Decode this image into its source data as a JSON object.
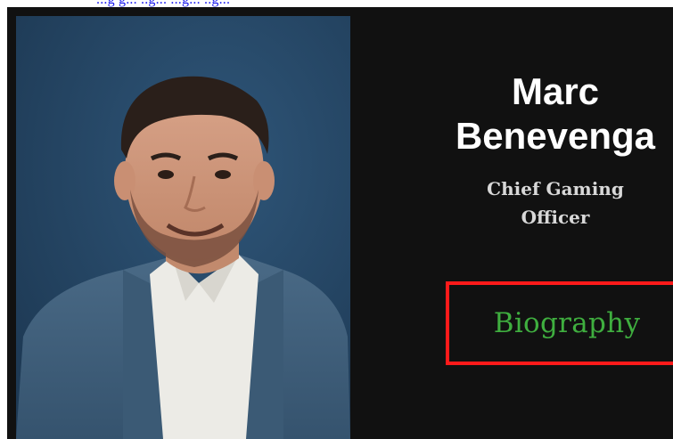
{
  "header": {
    "link_fragment": "...g g... ..g... ...g... ..g..."
  },
  "profile": {
    "photo_alt": "Portrait photo",
    "name_first": "Marc",
    "name_last": "Benevenga",
    "role_line1": "Chief Gaming",
    "role_line2": "Officer",
    "bio_button_label": "Biography"
  },
  "colors": {
    "card_background": "#111111",
    "name": "#ffffff",
    "role": "#d8d8d8",
    "bio_label": "#3fae3f",
    "bio_border": "#ff1a1a",
    "photo_backdrop": "#264766"
  },
  "icons": {}
}
